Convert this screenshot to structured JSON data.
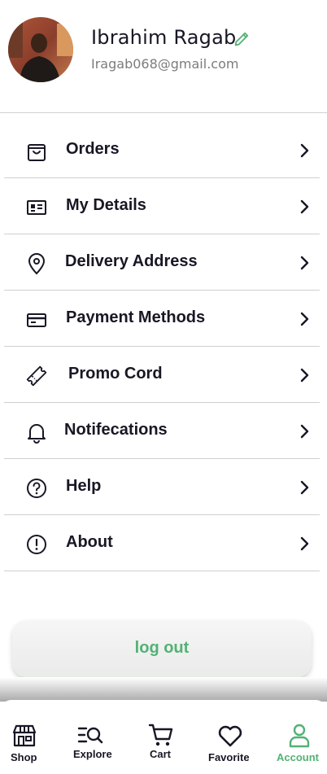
{
  "profile": {
    "name": "Ibrahim Ragab",
    "email": "Iragab068@gmail.com"
  },
  "menu": {
    "orders": "Orders",
    "my_details": "My Details",
    "delivery_address": "Delivery Address",
    "payment_methods": "Payment Methods",
    "promo_cord": "Promo Cord",
    "notifications": "Notifecations",
    "help": "Help",
    "about": "About"
  },
  "logout": {
    "label": "log out"
  },
  "nav": {
    "shop": "Shop",
    "explore": "Explore",
    "cart": "Cart",
    "favorite": "Favorite",
    "account": "Account"
  },
  "colors": {
    "accent": "#53b175",
    "text": "#181725",
    "muted": "#7c7c7c"
  }
}
